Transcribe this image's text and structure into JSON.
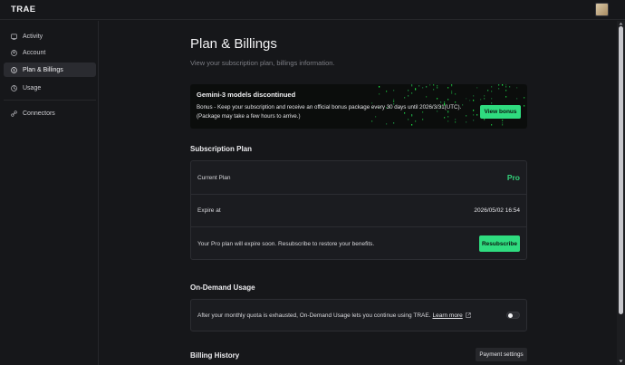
{
  "app": {
    "logo": "TRAE"
  },
  "sidebar": {
    "items": [
      {
        "label": "Activity",
        "icon": "activity-icon"
      },
      {
        "label": "Account",
        "icon": "account-icon"
      },
      {
        "label": "Plan & Billings",
        "icon": "billing-icon",
        "active": true
      },
      {
        "label": "Usage",
        "icon": "usage-icon"
      },
      {
        "label": "Connectors",
        "icon": "connectors-icon"
      }
    ]
  },
  "page": {
    "title": "Plan & Billings",
    "subtitle": "View your subscription plan, billings information."
  },
  "banner": {
    "title": "Gemini-3 models discontinued",
    "text": "Bonus - Keep your subscription and receive an official bonus package every 30 days until 2026/3/31(UTC). (Package may take a few hours to arrive.)",
    "button": "View bonus"
  },
  "subscription": {
    "section_title": "Subscription Plan",
    "current_plan_label": "Current Plan",
    "current_plan_value": "Pro",
    "expire_label": "Expire at",
    "expire_value": "2026/05/02 16:54",
    "notice": "Your Pro plan will expire soon. Resubscribe to restore your benefits.",
    "resubscribe_button": "Resubscribe"
  },
  "on_demand": {
    "section_title": "On-Demand Usage",
    "text": "After your monthly quota is exhausted, On-Demand Usage lets you continue using TRAE.",
    "learn_more": "Learn more",
    "toggle_on": false
  },
  "billing": {
    "section_title": "Billing History",
    "payment_button": "Payment settings"
  },
  "colors": {
    "accent": "#2fdc7f",
    "background": "#16171a",
    "card": "#1b1c20"
  }
}
